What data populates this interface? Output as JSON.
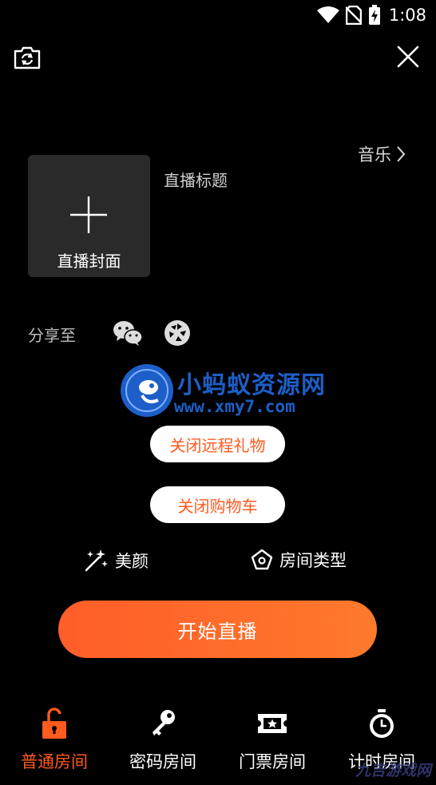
{
  "status_bar": {
    "time": "1:08"
  },
  "header": {
    "music_label": "音乐"
  },
  "cover": {
    "label": "直播封面"
  },
  "title": {
    "label": "直播标题",
    "placeholder": ""
  },
  "share": {
    "label": "分享至",
    "targets": [
      "wechat-icon",
      "moments-icon"
    ]
  },
  "watermark": {
    "cn": "小蚂蚁资源网",
    "url": "www.xmy7.com",
    "corner": "九吉游戏网"
  },
  "buttons": {
    "close_gift": "关闭远程礼物",
    "close_cart": "关闭购物车",
    "start_live": "开始直播"
  },
  "options": {
    "beauty": "美颜",
    "room_type": "房间类型"
  },
  "tabs": [
    {
      "label": "普通房间",
      "icon": "unlock-icon",
      "active": true
    },
    {
      "label": "密码房间",
      "icon": "key-icon",
      "active": false
    },
    {
      "label": "门票房间",
      "icon": "ticket-icon",
      "active": false
    },
    {
      "label": "计时房间",
      "icon": "stopwatch-icon",
      "active": false
    }
  ],
  "colors": {
    "accent": "#ff5a1f",
    "gradient_start": "#ff5d28",
    "gradient_end": "#ff7a2c",
    "cover_bg": "#2a2a2a"
  }
}
